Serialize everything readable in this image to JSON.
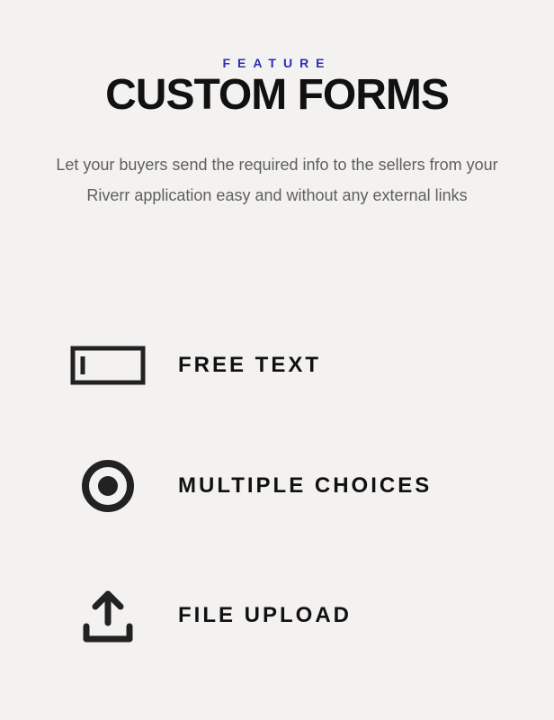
{
  "eyebrow": "FEATURE",
  "headline": "CUSTOM FORMS",
  "description": "Let your buyers send the required info to the sellers from your Riverr application easy and without any external links",
  "features": {
    "free_text": {
      "label": "FREE TEXT"
    },
    "multiple_choices": {
      "label": "MULTIPLE CHOICES"
    },
    "file_upload": {
      "label": "FILE UPLOAD"
    }
  }
}
